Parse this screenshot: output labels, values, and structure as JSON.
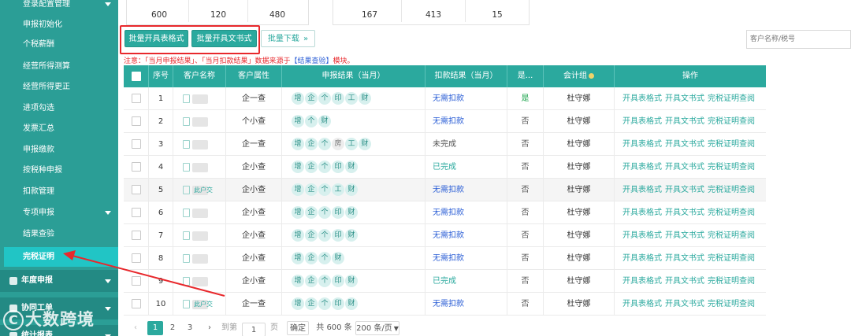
{
  "sidebar": {
    "items": [
      {
        "label": "登录配置管理",
        "caret": true
      },
      {
        "label": "申报初始化"
      },
      {
        "label": "个税薪酬"
      },
      {
        "label": "经营所得测算"
      },
      {
        "label": "经营所得更正"
      },
      {
        "label": "进项勾选"
      },
      {
        "label": "发票汇总"
      },
      {
        "label": "申报缴款"
      },
      {
        "label": "按税种申报"
      },
      {
        "label": "扣款管理"
      },
      {
        "label": "专项申报",
        "caret": true
      },
      {
        "label": "结果查验"
      },
      {
        "label": "完税证明",
        "active": true
      }
    ],
    "groups": [
      {
        "label": "年度申报"
      },
      {
        "label": "协同工单"
      },
      {
        "label": "统计报表"
      }
    ]
  },
  "stats": {
    "group1": [
      "600",
      "120",
      "480"
    ],
    "group2": [
      "167",
      "413",
      "15"
    ]
  },
  "toolbar": {
    "batch_table_label": "批量开具表格式",
    "batch_doc_label": "批量开具文书式",
    "batch_download_label": "批量下载",
    "search_placeholder": "客户名称/税号"
  },
  "notice": {
    "prefix": "注意：「当月申报结果」、「当月扣款结果」数据来源于",
    "link": "【结果查验】",
    "suffix": "模块。"
  },
  "table": {
    "headers": [
      "序号",
      "客户名称",
      "客户属性",
      "申报结果（当月）",
      "扣款结果（当月）",
      "是...",
      "会计组",
      "操作"
    ],
    "ops": [
      "开具表格式",
      "开具文书式",
      "完税证明查阅"
    ],
    "rows": [
      {
        "no": "1",
        "attr": "企一查",
        "tags": [
          "增",
          "企",
          "个",
          "印",
          "工",
          "财"
        ],
        "deduct": "无需扣款",
        "is": "是",
        "acct": "杜守娜"
      },
      {
        "no": "2",
        "attr": "个小查",
        "tags": [
          "增",
          "个",
          "财"
        ],
        "deduct": "无需扣款",
        "is": "否",
        "acct": "杜守娜"
      },
      {
        "no": "3",
        "attr": "企一查",
        "tags": [
          "增",
          "企",
          "个",
          "房",
          "工",
          "财"
        ],
        "deduct": "未完成",
        "is": "否",
        "acct": "杜守娜"
      },
      {
        "no": "4",
        "attr": "企小查",
        "tags": [
          "增",
          "企",
          "个",
          "印",
          "财"
        ],
        "deduct": "已完成",
        "is": "否",
        "acct": "杜守娜"
      },
      {
        "no": "5",
        "attr": "企小查",
        "tags": [
          "增",
          "企",
          "个",
          "工",
          "财"
        ],
        "deduct": "无需扣款",
        "is": "否",
        "acct": "杜守娜",
        "name_tag": "此户交"
      },
      {
        "no": "6",
        "attr": "企小查",
        "tags": [
          "增",
          "企",
          "个",
          "印",
          "财"
        ],
        "deduct": "无需扣款",
        "is": "否",
        "acct": "杜守娜"
      },
      {
        "no": "7",
        "attr": "企小查",
        "tags": [
          "增",
          "企",
          "个",
          "印",
          "财"
        ],
        "deduct": "无需扣款",
        "is": "否",
        "acct": "杜守娜"
      },
      {
        "no": "8",
        "attr": "企小查",
        "tags": [
          "增",
          "企",
          "个",
          "财"
        ],
        "deduct": "无需扣款",
        "is": "否",
        "acct": "杜守娜"
      },
      {
        "no": "9",
        "attr": "企小查",
        "tags": [
          "增",
          "企",
          "个",
          "印",
          "财"
        ],
        "deduct": "已完成",
        "is": "否",
        "acct": "杜守娜"
      },
      {
        "no": "10",
        "attr": "企一查",
        "tags": [
          "增",
          "企",
          "个",
          "印",
          "财"
        ],
        "deduct": "无需扣款",
        "is": "否",
        "acct": "杜守娜",
        "name_tag": "此户交"
      }
    ]
  },
  "pager": {
    "pages": [
      "1",
      "2",
      "3"
    ],
    "goto_label": "到第",
    "page_value": "1",
    "page_suffix": "页",
    "confirm_label": "确定",
    "total_label": "共 600 条",
    "page_size": "200 条/页"
  },
  "watermark": {
    "text": "大数跨境"
  },
  "colors": {
    "sidebar": "#2b9e96",
    "accent": "#2ba99e",
    "active_item": "#21c5c5",
    "annotation_red": "#e8282c",
    "link_blue": "#2c5fd6"
  }
}
